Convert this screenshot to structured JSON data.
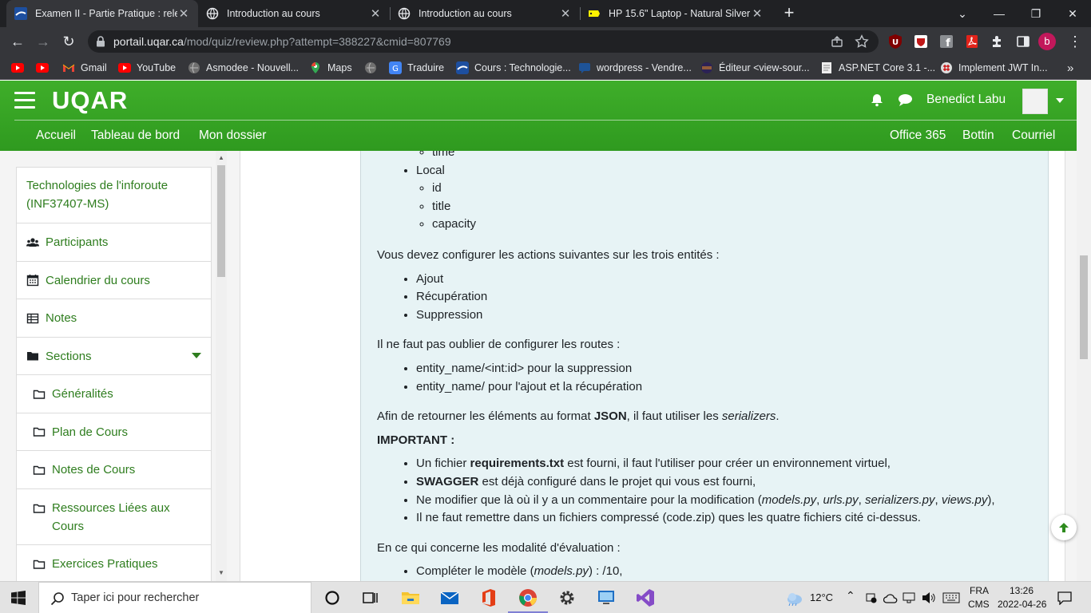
{
  "browser": {
    "tabs": [
      {
        "title": "Examen II - Partie Pratique : relec",
        "favicon": "uqar-icon"
      },
      {
        "title": "Introduction au cours",
        "favicon": "globe-icon"
      },
      {
        "title": "Introduction au cours",
        "favicon": "globe-icon"
      },
      {
        "title": "HP 15.6\" Laptop - Natural Silver (",
        "favicon": "bestbuy-icon"
      }
    ],
    "url_domain": "portail.uqar.ca",
    "url_path": "/mod/quiz/review.php?attempt=388227&cmid=807769",
    "profile_initial": "b",
    "bookmarks": [
      {
        "label": "",
        "icon": "youtube-icon"
      },
      {
        "label": "",
        "icon": "youtube-icon"
      },
      {
        "label": "Gmail",
        "icon": "gmail-icon"
      },
      {
        "label": "YouTube",
        "icon": "youtube-icon"
      },
      {
        "label": "Asmodee - Nouvell...",
        "icon": "globe-icon"
      },
      {
        "label": "Maps",
        "icon": "maps-icon"
      },
      {
        "label": "",
        "icon": "globe-icon"
      },
      {
        "label": "Traduire",
        "icon": "translate-icon"
      },
      {
        "label": "Cours : Technologie...",
        "icon": "uqar-icon"
      },
      {
        "label": "wordpress - Vendre...",
        "icon": "stackexchange-icon"
      },
      {
        "label": "Éditeur <view-sour...",
        "icon": "eclipse-icon"
      },
      {
        "label": "ASP.NET Core 3.1 -...",
        "icon": "page-icon"
      },
      {
        "label": "Implement JWT In...",
        "icon": "csharpcorner-icon"
      }
    ]
  },
  "site": {
    "logo": "UQAR",
    "username": "Benedict Labu",
    "nav_left": [
      "Accueil",
      "Tableau de bord",
      "Mon dossier"
    ],
    "nav_right": [
      "Office 365",
      "Bottin",
      "Courriel"
    ]
  },
  "sidebar": {
    "course": "Technologies de l'inforoute (INF37407-MS)",
    "items": [
      {
        "label": "Participants",
        "icon": "users-icon"
      },
      {
        "label": "Calendrier du cours",
        "icon": "calendar-icon"
      },
      {
        "label": "Notes",
        "icon": "table-icon"
      },
      {
        "label": "Sections",
        "icon": "folder-icon"
      },
      {
        "label": "Généralités",
        "icon": "folder-outline-icon"
      },
      {
        "label": "Plan de Cours",
        "icon": "folder-outline-icon"
      },
      {
        "label": "Notes de Cours",
        "icon": "folder-outline-icon"
      },
      {
        "label": "Ressources Liées aux Cours",
        "icon": "folder-outline-icon"
      },
      {
        "label": "Exercices Pratiques",
        "icon": "folder-outline-icon"
      }
    ]
  },
  "question": {
    "top_partial": "time",
    "entity_local": "Local",
    "local_fields": [
      "id",
      "title",
      "capacity"
    ],
    "actions_intro": "Vous devez configurer les actions suivantes sur les trois entités :",
    "actions": [
      "Ajout",
      "Récupération",
      "Suppression"
    ],
    "routes_intro": "Il ne faut pas oublier de configurer les routes :",
    "routes": [
      "entity_name/<int:id> pour la suppression",
      "entity_name/ pour l'ajout et la récupération"
    ],
    "json_text_1": "Afin de retourner les éléments au format ",
    "json_bold": "JSON",
    "json_text_2": ", il faut utiliser les ",
    "json_em": "serializers",
    "json_text_3": ".",
    "important": "IMPORTANT :",
    "imp1_a": "Un fichier ",
    "imp1_b": "requirements.txt",
    "imp1_c": " est fourni, il faut l'utiliser pour créer un environnement virtuel,",
    "imp2_a": "SWAGGER",
    "imp2_b": " est déjà configuré dans le projet qui vous est fourni,",
    "imp3_a": "Ne modifier que là où il y a un commentaire pour la modification (",
    "imp3_b": "models.py",
    "imp3_sep1": ", ",
    "imp3_c": "urls.py",
    "imp3_sep2": ", ",
    "imp3_d": "serializers.py",
    "imp3_sep3": ", ",
    "imp3_e": "views.py",
    "imp3_f": "),",
    "imp4": "Il ne faut remettre dans un fichiers compressé (code.zip) ques les quatre fichiers cité ci-dessus.",
    "eval_intro": "En ce qui concerne les modalité d'évaluation :",
    "eval1_a": "Compléter le modèle (",
    "eval1_b": "models.py",
    "eval1_c": ") : /10,"
  },
  "taskbar": {
    "search_placeholder": "Taper ici pour rechercher",
    "weather": "12°C",
    "lang_1": "FRA",
    "lang_2": "CMS",
    "time": "13:26",
    "date": "2022-04-26"
  },
  "colors": {
    "uqar_green": "#35a323",
    "link_green": "#2e7d1e",
    "question_bg": "#e7f3f5"
  }
}
